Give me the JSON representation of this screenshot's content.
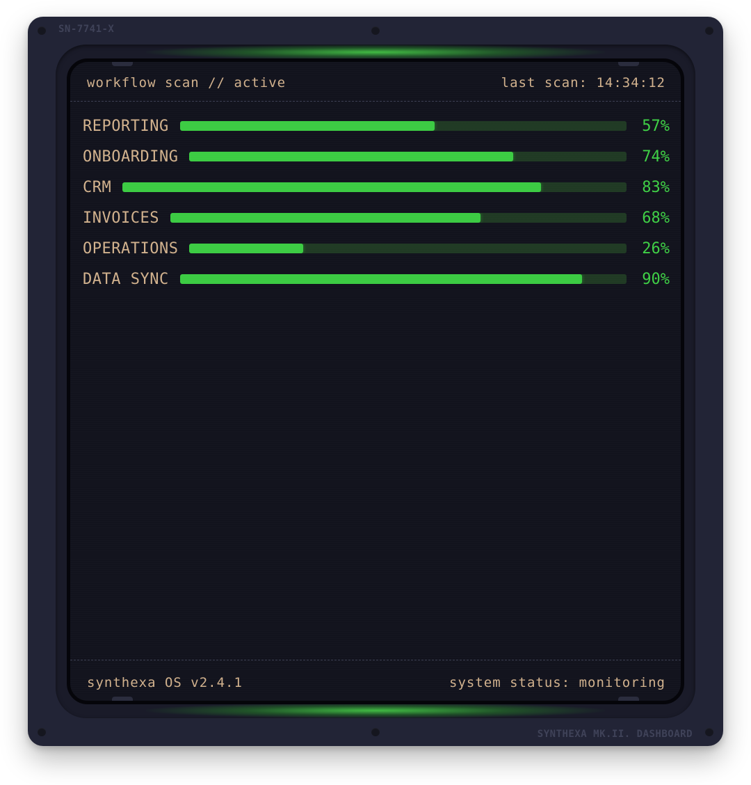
{
  "device": {
    "serial": "SN-7741-X",
    "model": "SYNTHEXA MK.II. DASHBOARD"
  },
  "header": {
    "title": "workflow scan // active",
    "last_scan": "last scan: 14:34:12"
  },
  "workflows": [
    {
      "label": "REPORTING",
      "value": 57,
      "value_label": "57%"
    },
    {
      "label": "ONBOARDING",
      "value": 74,
      "value_label": "74%"
    },
    {
      "label": "CRM",
      "value": 83,
      "value_label": "83%"
    },
    {
      "label": "INVOICES",
      "value": 68,
      "value_label": "68%"
    },
    {
      "label": "OPERATIONS",
      "value": 26,
      "value_label": "26%"
    },
    {
      "label": "DATA SYNC",
      "value": 90,
      "value_label": "90%"
    }
  ],
  "footer": {
    "os": "synthexa OS v2.4.1",
    "status": "system status: monitoring"
  },
  "colors": {
    "panel": "#222436",
    "screen": "#12131d",
    "label": "#d2b28e",
    "accent": "#3ccb43",
    "track": "#203a24"
  }
}
